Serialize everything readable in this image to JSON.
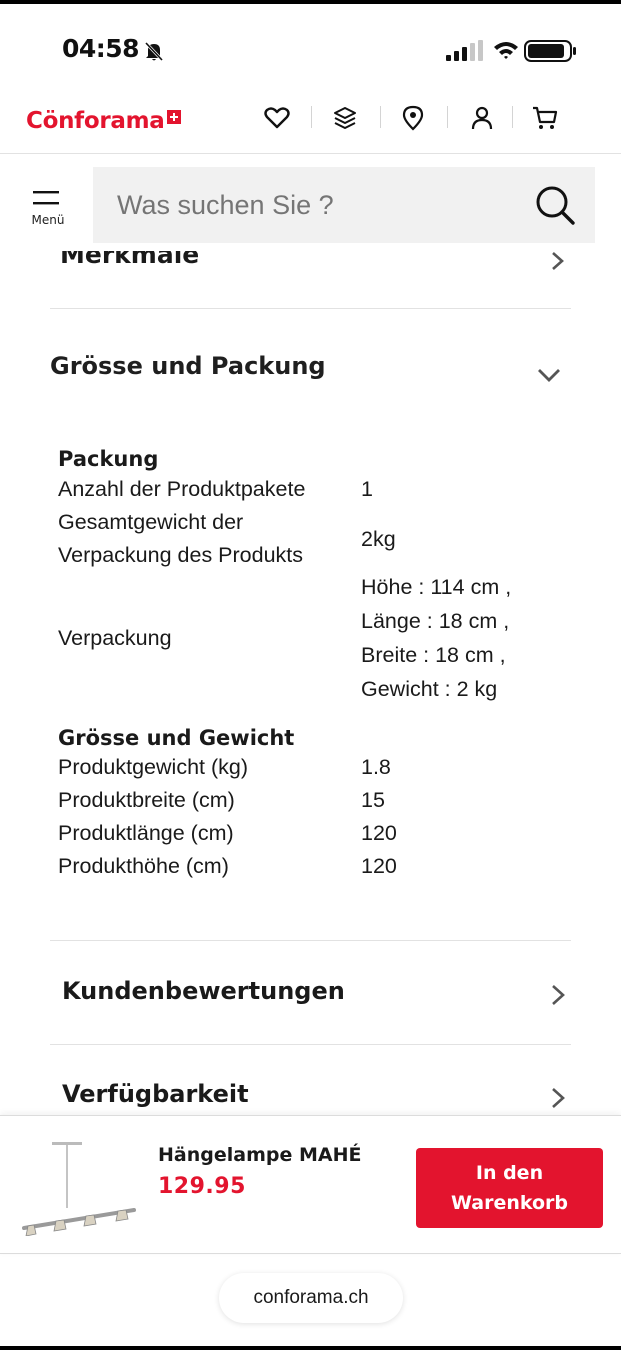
{
  "status_bar": {
    "time": "04:58"
  },
  "header": {
    "logo_text": "Cönforama",
    "icons": [
      "heart-icon",
      "layers-icon",
      "location-pin-icon",
      "user-icon",
      "cart-icon"
    ]
  },
  "search": {
    "menu_label": "Menü",
    "placeholder": "Was suchen Sie ?"
  },
  "sections": {
    "cut_title": "Merkmale",
    "size_pack_title": "Grösse und Packung",
    "reviews_title": "Kundenbewertungen",
    "availability_title": "Verfügbarkeit"
  },
  "specs": {
    "packung_heading": "Packung",
    "packung_rows": [
      {
        "label": "Anzahl der Produktpakete",
        "value": "1"
      },
      {
        "label_line1": "Gesamtgewicht der",
        "label_line2": "Verpackung des Produkts",
        "value": "2kg"
      },
      {
        "label": "Verpackung",
        "value_lines": [
          "Höhe : 114 cm ,",
          "Länge : 18 cm ,",
          "Breite : 18 cm ,",
          "Gewicht : 2 kg"
        ]
      }
    ],
    "groesse_heading": "Grösse und Gewicht",
    "groesse_rows": [
      {
        "label": "Produktgewicht (kg)",
        "value": "1.8"
      },
      {
        "label": "Produktbreite (cm)",
        "value": "15"
      },
      {
        "label": "Produktlänge (cm)",
        "value": "120"
      },
      {
        "label": "Produkthöhe (cm)",
        "value": "120"
      }
    ]
  },
  "product_bar": {
    "name": "Hängelampe MAHÉ",
    "price": "129.95",
    "button_line1": "In den",
    "button_line2": "Warenkorb"
  },
  "browser": {
    "url": "conforama.ch"
  },
  "colors": {
    "brand_red": "#e3142e"
  }
}
